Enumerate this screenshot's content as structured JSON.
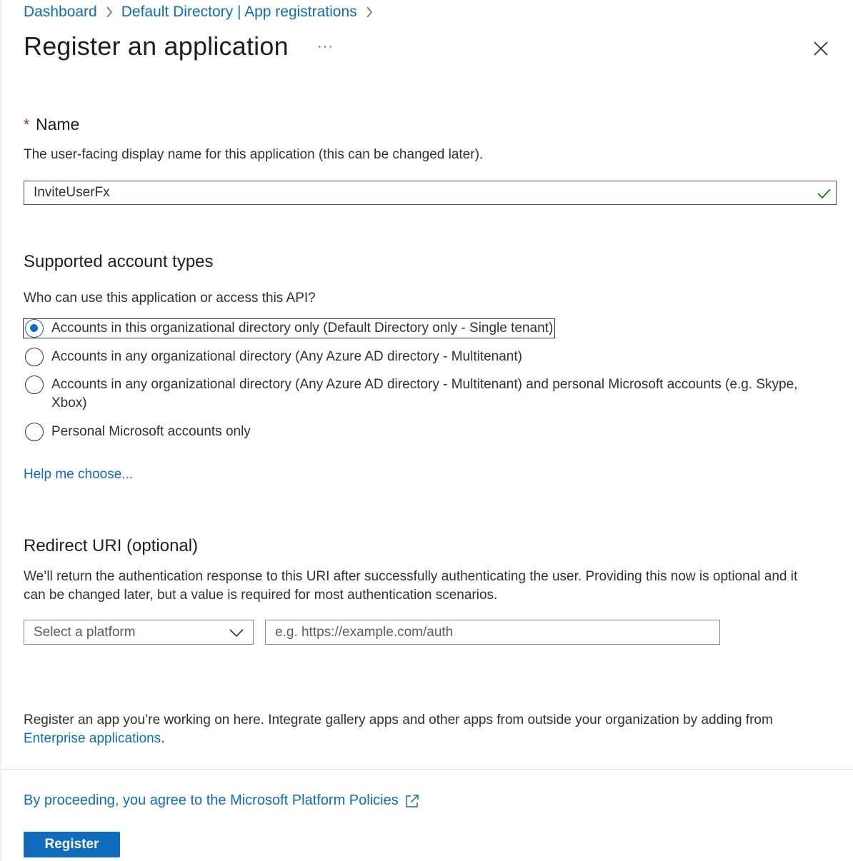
{
  "breadcrumb": {
    "items": [
      "Dashboard",
      "Default Directory | App registrations"
    ]
  },
  "header": {
    "title": "Register an application",
    "more_label": "···"
  },
  "name_section": {
    "required_mark": "*",
    "label": "Name",
    "description": "The user-facing display name for this application (this can be changed later).",
    "value": "InviteUserFx",
    "valid": true
  },
  "account_types": {
    "heading": "Supported account types",
    "question": "Who can use this application or access this API?",
    "options": [
      {
        "label": "Accounts in this organizational directory only (Default Directory only - Single tenant)",
        "selected": true
      },
      {
        "label": "Accounts in any organizational directory (Any Azure AD directory - Multitenant)",
        "selected": false
      },
      {
        "label_line1": "Accounts in any organizational directory (Any Azure AD directory - Multitenant) and personal Microsoft accounts (e.g. Skype,",
        "label_line2": "Xbox)",
        "selected": false
      },
      {
        "label": "Personal Microsoft accounts only",
        "selected": false
      }
    ],
    "help_link": "Help me choose..."
  },
  "redirect": {
    "heading": "Redirect URI (optional)",
    "description_line1": "We’ll return the authentication response to this URI after successfully authenticating the user. Providing this now is optional and it",
    "description_line2": "can be changed later, but a value is required for most authentication scenarios.",
    "platform_placeholder": "Select a platform",
    "uri_placeholder": "e.g. https://example.com/auth"
  },
  "footer": {
    "note_line1": "Register an app you’re working on here. Integrate gallery apps and other apps from outside your organization by adding from",
    "note_link": "Enterprise applications",
    "note_end": ".",
    "policy_link": "By proceeding, you agree to the Microsoft Platform Policies",
    "register_label": "Register"
  },
  "colors": {
    "accent": "#0f6cbd",
    "required": "#a4262c",
    "valid_check": "#107c10",
    "input_focus_border": "#6b3fa0"
  }
}
